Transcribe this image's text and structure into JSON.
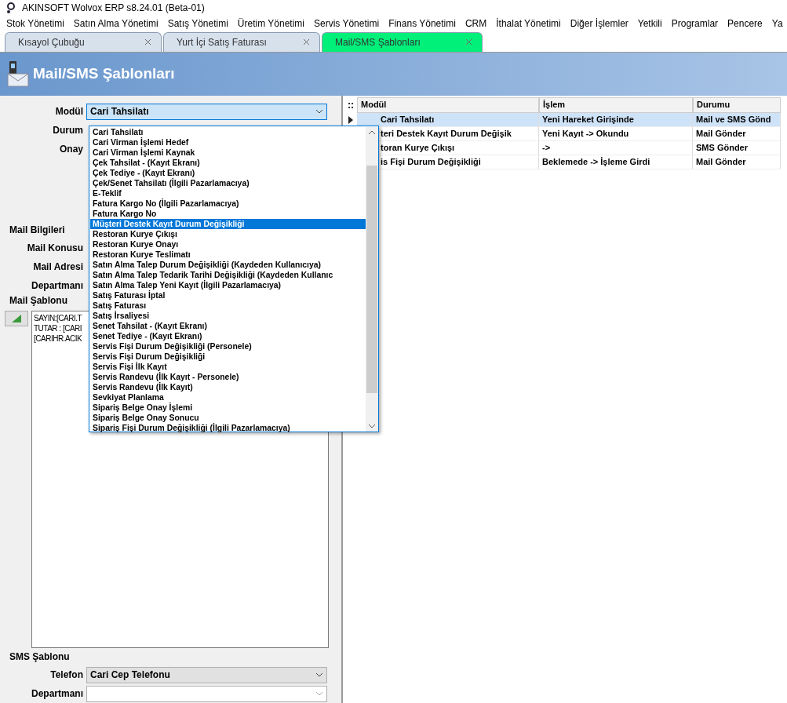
{
  "window": {
    "title": "AKINSOFT Wolvox ERP s8.24.01 (Beta-01)"
  },
  "menu": [
    "Stok Yönetimi",
    "Satın Alma Yönetimi",
    "Satış Yönetimi",
    "Üretim Yönetimi",
    "Servis Yönetimi",
    "Finans Yönetimi",
    "CRM",
    "İthalat Yönetimi",
    "Diğer İşlemler",
    "Yetkili",
    "Programlar",
    "Pencere",
    "Ya"
  ],
  "tabs": [
    {
      "label": "Kısayol Çubuğu",
      "selected": false
    },
    {
      "label": "Yurt İçi Satış Faturası",
      "selected": false
    },
    {
      "label": "Mail/SMS Şablonları",
      "selected": true
    }
  ],
  "header": {
    "title": "Mail/SMS Şablonları"
  },
  "form": {
    "modul_label": "Modül",
    "modul_value": "Cari Tahsilatı",
    "durum_label": "Durum",
    "onay_label": "Onay",
    "mail_group": "Mail Bilgileri",
    "mail_konusu_label": "Mail Konusu",
    "mail_adresi_label": "Mail Adresi",
    "departman_label": "Departmanı",
    "template_group": "Mail Şablonu",
    "template_lines": [
      "SAYIN:[CARI.T",
      "TUTAR : [CARI",
      "[CARIHR.ACIK"
    ],
    "sms_group": "SMS Şablonu",
    "telefon_label": "Telefon",
    "telefon_value": "Cari Cep Telefonu",
    "sms_departman_label": "Departmanı"
  },
  "dropdown": {
    "items": [
      {
        "label": "Cari Tahsilatı",
        "selected": false
      },
      {
        "label": "Cari Virman İşlemi Hedef",
        "selected": false
      },
      {
        "label": "Cari Virman İşlemi Kaynak",
        "selected": false
      },
      {
        "label": "Çek Tahsilat - (Kayıt Ekranı)",
        "selected": false
      },
      {
        "label": "Çek Tediye - (Kayıt Ekranı)",
        "selected": false
      },
      {
        "label": "Çek/Senet Tahsilatı (İlgili Pazarlamacıya)",
        "selected": false
      },
      {
        "label": "E-Teklif",
        "selected": false
      },
      {
        "label": "Fatura Kargo No (İlgili Pazarlamacıya)",
        "selected": false
      },
      {
        "label": "Fatura Kargo No",
        "selected": false
      },
      {
        "label": "Müşteri Destek Kayıt Durum Değişikliği",
        "selected": true
      },
      {
        "label": "Restoran Kurye Çıkışı",
        "selected": false
      },
      {
        "label": "Restoran Kurye Onayı",
        "selected": false
      },
      {
        "label": "Restoran Kurye Teslimatı",
        "selected": false
      },
      {
        "label": "Satın Alma Talep Durum Değişikliği (Kaydeden Kullanıcıya)",
        "selected": false
      },
      {
        "label": "Satın Alma Talep Tedarik Tarihi Değişikliği (Kaydeden Kullanıc",
        "selected": false
      },
      {
        "label": "Satın Alma Talep Yeni Kayıt (İlgili Pazarlamacıya)",
        "selected": false
      },
      {
        "label": "Satış Faturası İptal",
        "selected": false
      },
      {
        "label": "Satış Faturası",
        "selected": false
      },
      {
        "label": "Satış İrsaliyesi",
        "selected": false
      },
      {
        "label": "Senet Tahsilat - (Kayıt Ekranı)",
        "selected": false
      },
      {
        "label": "Senet Tediye - (Kayıt Ekranı)",
        "selected": false
      },
      {
        "label": "Servis Fişi Durum Değişikliği (Personele)",
        "selected": false
      },
      {
        "label": "Servis Fişi Durum Değişikliği",
        "selected": false
      },
      {
        "label": "Servis Fişi İlk Kayıt",
        "selected": false
      },
      {
        "label": "Servis Randevu (İlk Kayıt - Personele)",
        "selected": false
      },
      {
        "label": "Servis Randevu (İlk Kayıt)",
        "selected": false
      },
      {
        "label": "Sevkiyat Planlama",
        "selected": false
      },
      {
        "label": "Sipariş Belge Onay İşlemi",
        "selected": false
      },
      {
        "label": "Sipariş Belge Onay Sonucu",
        "selected": false
      },
      {
        "label": "Sipariş Fişi Durum Değişikliği (İlgili Pazarlamacıya)",
        "selected": false
      }
    ]
  },
  "table": {
    "columns": [
      "Modül",
      "İşlem",
      "Durumu"
    ],
    "rows": [
      {
        "cells": [
          "Cari Tahsilatı",
          "Yeni Hareket Girişinde",
          "Mail ve SMS Gönd"
        ],
        "selected": true
      },
      {
        "cells": [
          "teri Destek Kayıt Durum Değişik",
          "Yeni Kayıt -> Okundu",
          "Mail Gönder"
        ],
        "selected": false
      },
      {
        "cells": [
          "toran Kurye Çıkışı",
          "->",
          "SMS Gönder"
        ],
        "selected": false
      },
      {
        "cells": [
          "is Fişi Durum Değişikliği",
          "Beklemede -> İşleme Girdi",
          "Mail Gönder"
        ],
        "selected": false
      }
    ]
  }
}
